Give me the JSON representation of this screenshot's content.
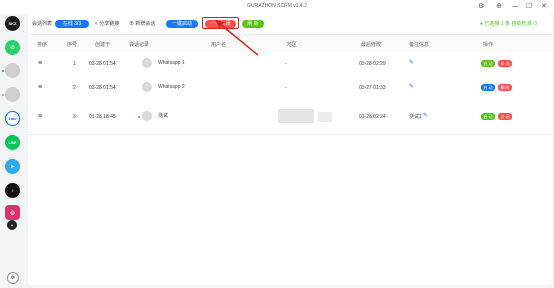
{
  "app": {
    "title": "GURAZHON SCRM v1.4.2"
  },
  "window_controls": [
    "⚙",
    "⊕",
    "—",
    "☐",
    "✕"
  ],
  "sidebar": {
    "logo": "SKZ",
    "apps": [
      {
        "name": "whatsapp",
        "color": "#25d366",
        "glyph": "✆"
      },
      {
        "name": "avatar-1",
        "color": "#c8c8c8",
        "glyph": ""
      },
      {
        "name": "avatar-2",
        "color": "#c8c8c8",
        "glyph": ""
      },
      {
        "name": "zalo",
        "color": "#0068ff",
        "glyph": "Zalo"
      },
      {
        "name": "line",
        "color": "#06c755",
        "glyph": "LINE"
      },
      {
        "name": "telegram",
        "color": "#2aabee",
        "glyph": "➤"
      },
      {
        "name": "tiktok",
        "color": "#111111",
        "glyph": "♪"
      },
      {
        "name": "instagram",
        "color": "#e1306c",
        "glyph": "◎"
      },
      {
        "name": "more",
        "color": "#222222",
        "glyph": "⌄"
      }
    ],
    "bottom_icon": "⟳"
  },
  "toolbar": {
    "label_conversations": "会话列表",
    "badge": "在线 3/3",
    "share_link": "< 分享链接",
    "add_session": "⊕ 新增会话",
    "btn_start": "一键启动",
    "btn_close": "一键关闭",
    "btn_refresh": "刷 新",
    "right_status": "● 已连接 1 条 自动检测 ⊙"
  },
  "table": {
    "columns": [
      "排序",
      "序号",
      "创建于",
      "会话记录",
      "用户名",
      "地区",
      "最后修改",
      "备注信息",
      "操作"
    ],
    "rows": [
      {
        "sort": "≡",
        "index": "1",
        "created": "03-28 01:54",
        "session": "Whatsapp 1",
        "user": "",
        "region": "-",
        "modified": "03-28 02:29",
        "note": "",
        "actions": [
          "启 动",
          "关 闭"
        ]
      },
      {
        "sort": "≡",
        "index": "2",
        "created": "03-28 01:54",
        "session": "Whatsapp 2",
        "user": "",
        "region": "-",
        "modified": "03-27 01:33",
        "note": "",
        "actions": [
          "启 动",
          "删 除"
        ]
      },
      {
        "sort": "≡",
        "index": "3",
        "created": "01-28 18:45",
        "session": "测试",
        "user": "",
        "region": "",
        "modified": "03-28 02:24",
        "note": "测试1",
        "actions": [
          "启 动",
          "关 闭"
        ]
      }
    ]
  },
  "colors": {
    "accent": "#1677ff",
    "danger": "#ff4d4f",
    "success": "#52c41a",
    "annotation": "#e02020"
  }
}
